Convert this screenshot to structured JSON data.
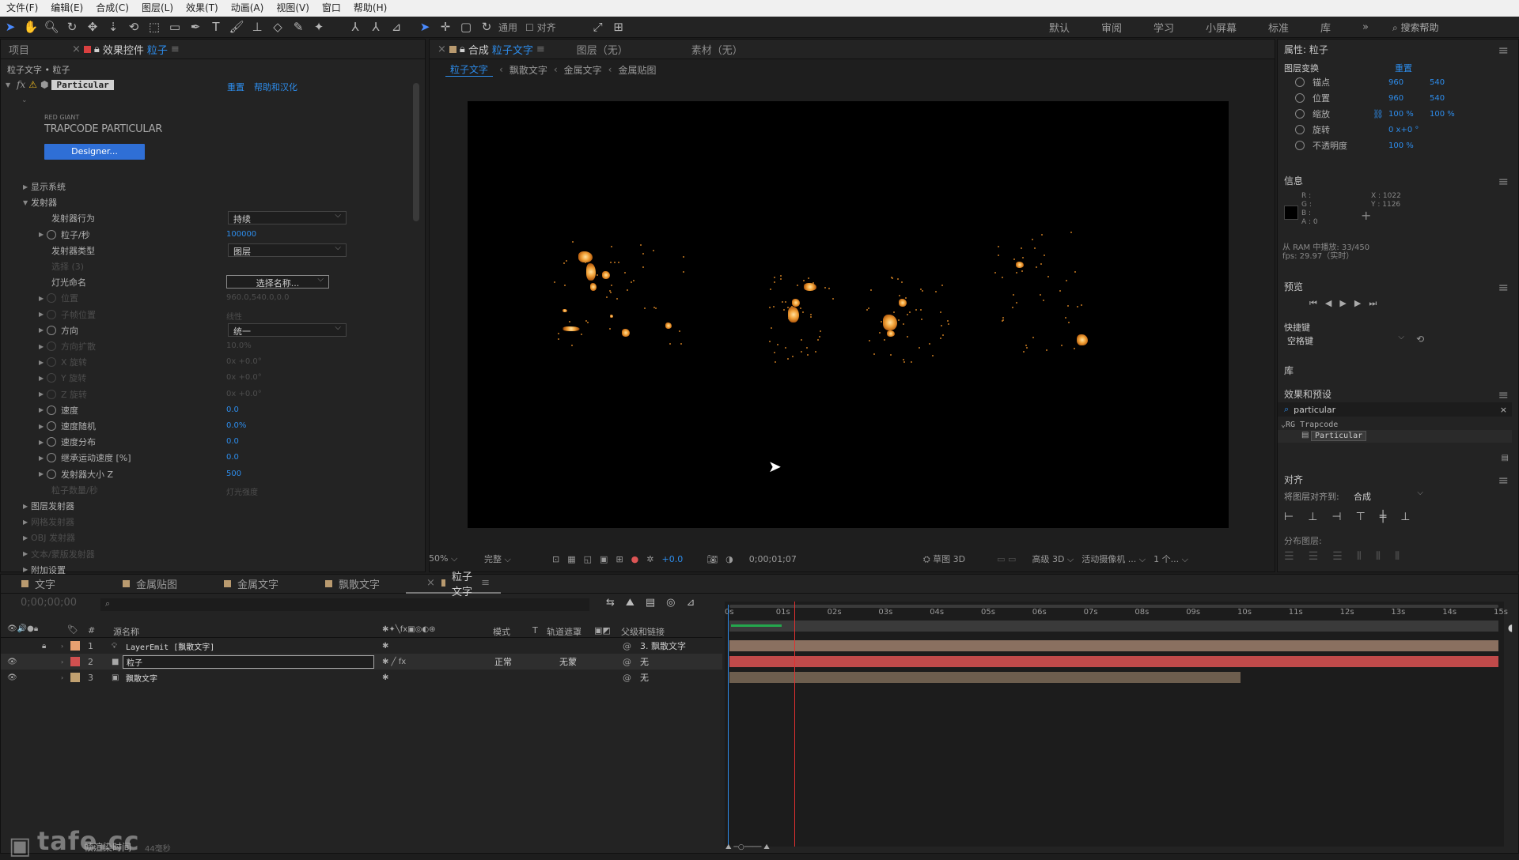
{
  "menu": [
    "文件(F)",
    "编辑(E)",
    "合成(C)",
    "图层(L)",
    "效果(T)",
    "动画(A)",
    "视图(V)",
    "窗口",
    "帮助(H)"
  ],
  "toolbar": {
    "snap_label": "通用",
    "align_label": "对齐",
    "workspaces": [
      "默认",
      "审阅",
      "学习",
      "小屏幕",
      "标准",
      "库"
    ],
    "more": "»",
    "search_placeholder": "搜索帮助"
  },
  "left_panel": {
    "tab_project": "项目",
    "tab_effects_prefix": "效果控件",
    "tab_effects_layer": "粒子",
    "breadcrumb": "粒子文字 • 粒子",
    "effect_name": "Particular",
    "reset_label": "重置",
    "extra_link": "帮助和汉化",
    "brand_small": "RED GIANT",
    "brand_big": "TRAPCODE PARTICULAR",
    "designer_button": "Designer...",
    "params": [
      {
        "label": "显示系统",
        "type": "group",
        "dim": false
      },
      {
        "label": "发射器",
        "type": "group-open",
        "dim": false
      },
      {
        "label": "发射器行为",
        "value": "持续",
        "type": "dropdown",
        "dim": false
      },
      {
        "label": "粒子/秒",
        "value": "100000",
        "type": "value",
        "dim": false,
        "sw": true
      },
      {
        "label": "发射器类型",
        "value": "图层",
        "type": "dropdown",
        "dim": false
      },
      {
        "label": "选择 (3)",
        "value": "",
        "type": "dim",
        "dim": true
      },
      {
        "label": "灯光命名",
        "value": "选择名称...",
        "type": "button",
        "dim": false
      },
      {
        "label": "位置",
        "value": "960.0,540.0,0.0",
        "type": "dim",
        "dim": true,
        "sw": true
      },
      {
        "label": "子帧位置",
        "value": "线性",
        "type": "dim",
        "dim": true,
        "sw": true
      },
      {
        "label": "方向",
        "value": "统一",
        "type": "dropdown",
        "dim": false,
        "sw": true
      },
      {
        "label": "方向扩散",
        "value": "10.0%",
        "type": "dim",
        "dim": true,
        "sw": true
      },
      {
        "label": "X 旋转",
        "value": "0x +0.0°",
        "type": "dim",
        "dim": true,
        "sw": true
      },
      {
        "label": "Y 旋转",
        "value": "0x +0.0°",
        "type": "dim",
        "dim": true,
        "sw": true
      },
      {
        "label": "Z 旋转",
        "value": "0x +0.0°",
        "type": "dim",
        "dim": true,
        "sw": true
      },
      {
        "label": "速度",
        "value": "0.0",
        "type": "value",
        "dim": false,
        "sw": true
      },
      {
        "label": "速度随机",
        "value": "0.0%",
        "type": "value",
        "dim": false,
        "sw": true
      },
      {
        "label": "速度分布",
        "value": "0.0",
        "type": "value",
        "dim": false,
        "sw": true
      },
      {
        "label": "继承运动速度 [%]",
        "value": "0.0",
        "type": "value",
        "dim": false,
        "sw": true
      },
      {
        "label": "发射器大小 Z",
        "value": "500",
        "type": "value",
        "dim": false,
        "sw": true
      },
      {
        "label": "粒子数量/秒",
        "value": "灯光强度",
        "type": "dim",
        "dim": true
      },
      {
        "label": "图层发射器",
        "type": "group",
        "dim": false
      },
      {
        "label": "网格发射器",
        "type": "group",
        "dim": true
      },
      {
        "label": "OBJ 发射器",
        "type": "group",
        "dim": true
      },
      {
        "label": "文本/蒙版发射器",
        "type": "group",
        "dim": true
      },
      {
        "label": "附加设置",
        "type": "group",
        "dim": false
      }
    ]
  },
  "comp_panel": {
    "tab_comp_prefix": "合成",
    "tab_comp_name": "粒子文字",
    "tab_layer": "图层（无）",
    "tab_footage": "素材（无）",
    "crumbs": [
      "粒子文字",
      "飘散文字",
      "金属文字",
      "金属贴图"
    ],
    "zoom": "50%",
    "resolution": "完整",
    "exposure": "+0.0",
    "timecode": "0;00;01;07",
    "draft3d": "草图 3D",
    "renderer": "高级 3D",
    "camera": "活动摄像机 ...",
    "views": "1 个..."
  },
  "right_panel": {
    "props_title": "属性: 粒子",
    "layer_transform": "图层变换",
    "reset": "重置",
    "props": [
      {
        "label": "锚点",
        "v1": "960",
        "v2": "540"
      },
      {
        "label": "位置",
        "v1": "960",
        "v2": "540"
      },
      {
        "label": "缩放",
        "v1": "100 %",
        "v2": "100 %"
      },
      {
        "label": "旋转",
        "v1": "0 x+0 °",
        "v2": ""
      },
      {
        "label": "不透明度",
        "v1": "100 %",
        "v2": ""
      }
    ],
    "info_title": "信息",
    "info_rgba": [
      "R :",
      "G :",
      "B :",
      "A :  0"
    ],
    "info_x": "X : 1022",
    "info_y": "Y : 1126",
    "ram_line": "从 RAM 中播放: 33/450",
    "fps_line": "fps: 29.97（实时）",
    "preview_title": "预览",
    "shortcut_label": "快捷键",
    "shortcut_value": "空格键",
    "library_title": "库",
    "effects_title": "效果和预设",
    "effects_search": "particular",
    "effects_group": "RG Trapcode",
    "effects_item": "Particular",
    "align_title": "对齐",
    "align_to_label": "将图层对齐到:",
    "align_to_value": "合成",
    "distribute_label": "分布图层:"
  },
  "timeline": {
    "tabs": [
      "文字",
      "金属贴图",
      "金属文字",
      "飘散文字",
      "粒子文字"
    ],
    "tab_colors": [
      "#b99a6f",
      "#b99a6f",
      "#b99a6f",
      "#b99a6f",
      "#b99a6f"
    ],
    "timecode": "0;00;00;00",
    "col_source": "源名称",
    "col_mode": "模式",
    "col_t": "T",
    "col_track": "轨道遮罩",
    "col_parent": "父级和链接",
    "ruler": [
      "0s",
      "01s",
      "02s",
      "03s",
      "04s",
      "05s",
      "06s",
      "07s",
      "08s",
      "09s",
      "10s",
      "11s",
      "12s",
      "13s",
      "14s",
      "15s"
    ],
    "layers": [
      {
        "num": "1",
        "name": "LayerEmit [飘散文字]",
        "color": "#e8a070",
        "mode": "",
        "track": "",
        "parent": "3. 飘散文字",
        "bar": "#8a7060",
        "selected": false
      },
      {
        "num": "2",
        "name": "粒子",
        "color": "#d05050",
        "mode": "正常",
        "track": "无蒙",
        "parent": "无",
        "bar": "#c04a4a",
        "selected": true
      },
      {
        "num": "3",
        "name": "飘散文字",
        "color": "#c0a070",
        "mode": "",
        "track": "",
        "parent": "无",
        "bar": "#6d5e4e",
        "selected": false
      }
    ],
    "footer_label": "帧渲染时间",
    "footer_value": "44毫秒",
    "layer3_end_fraction": 0.665,
    "playhead_fraction": 0.084
  },
  "watermark": "tafe.cc"
}
